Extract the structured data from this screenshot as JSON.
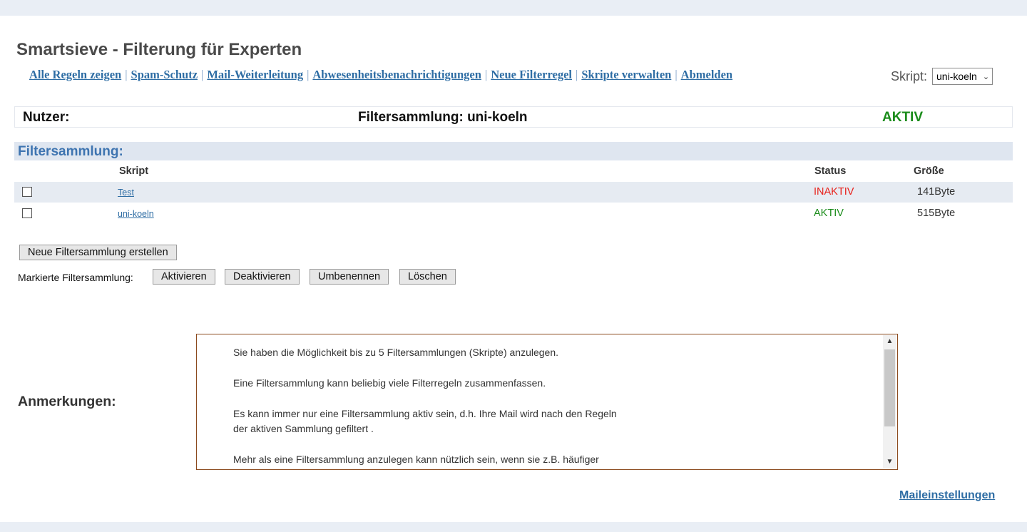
{
  "header": {
    "title": "Smartsieve - Filterung für Experten"
  },
  "nav": {
    "items": [
      "Alle Regeln zeigen",
      "Spam-Schutz",
      "Mail-Weiterleitung",
      "Abwesenheitsbenachrichtigungen",
      "Neue Filterregel",
      "Skripte verwalten",
      "Abmelden"
    ],
    "separator": "|"
  },
  "script_select": {
    "label": "Skript:",
    "value": "uni-koeln"
  },
  "info_bar": {
    "user_label": "Nutzer:",
    "collection_label": "Filtersammlung: uni-koeln",
    "status": "AKTIV"
  },
  "section": {
    "title": "Filtersammlung:"
  },
  "table": {
    "headers": {
      "script": "Skript",
      "status": "Status",
      "size": "Größe"
    },
    "rows": [
      {
        "name": "Test",
        "status": "INAKTIV",
        "size": "141Byte"
      },
      {
        "name": "uni-koeln",
        "status": "AKTIV",
        "size": "515Byte"
      }
    ]
  },
  "actions": {
    "new_collection": "Neue Filtersammlung erstellen",
    "marked_label": "Markierte Filtersammlung:",
    "activate": "Aktivieren",
    "deactivate": "Deaktivieren",
    "rename": "Umbenennen",
    "delete": "Löschen"
  },
  "notes": {
    "label": "Anmerkungen:",
    "paragraphs": [
      "Sie haben die Möglichkeit bis zu 5 Filtersammlungen (Skripte) anzulegen.",
      "Eine Filtersammlung kann beliebig viele Filterregeln zusammenfassen.",
      "Es kann immer nur eine Filtersammlung aktiv sein, d.h. Ihre Mail wird nach den Regeln",
      "der aktiven Sammlung gefiltert .",
      "Mehr als eine Filtersammlung anzulegen kann nützlich sein, wenn sie z.B. häufiger"
    ]
  },
  "footer": {
    "mail_settings": "Maileinstellungen"
  },
  "colors": {
    "link": "#2e6da4",
    "active": "#1b8c1b",
    "inactive": "#e8201a",
    "section_bg": "#dfe6f0"
  }
}
